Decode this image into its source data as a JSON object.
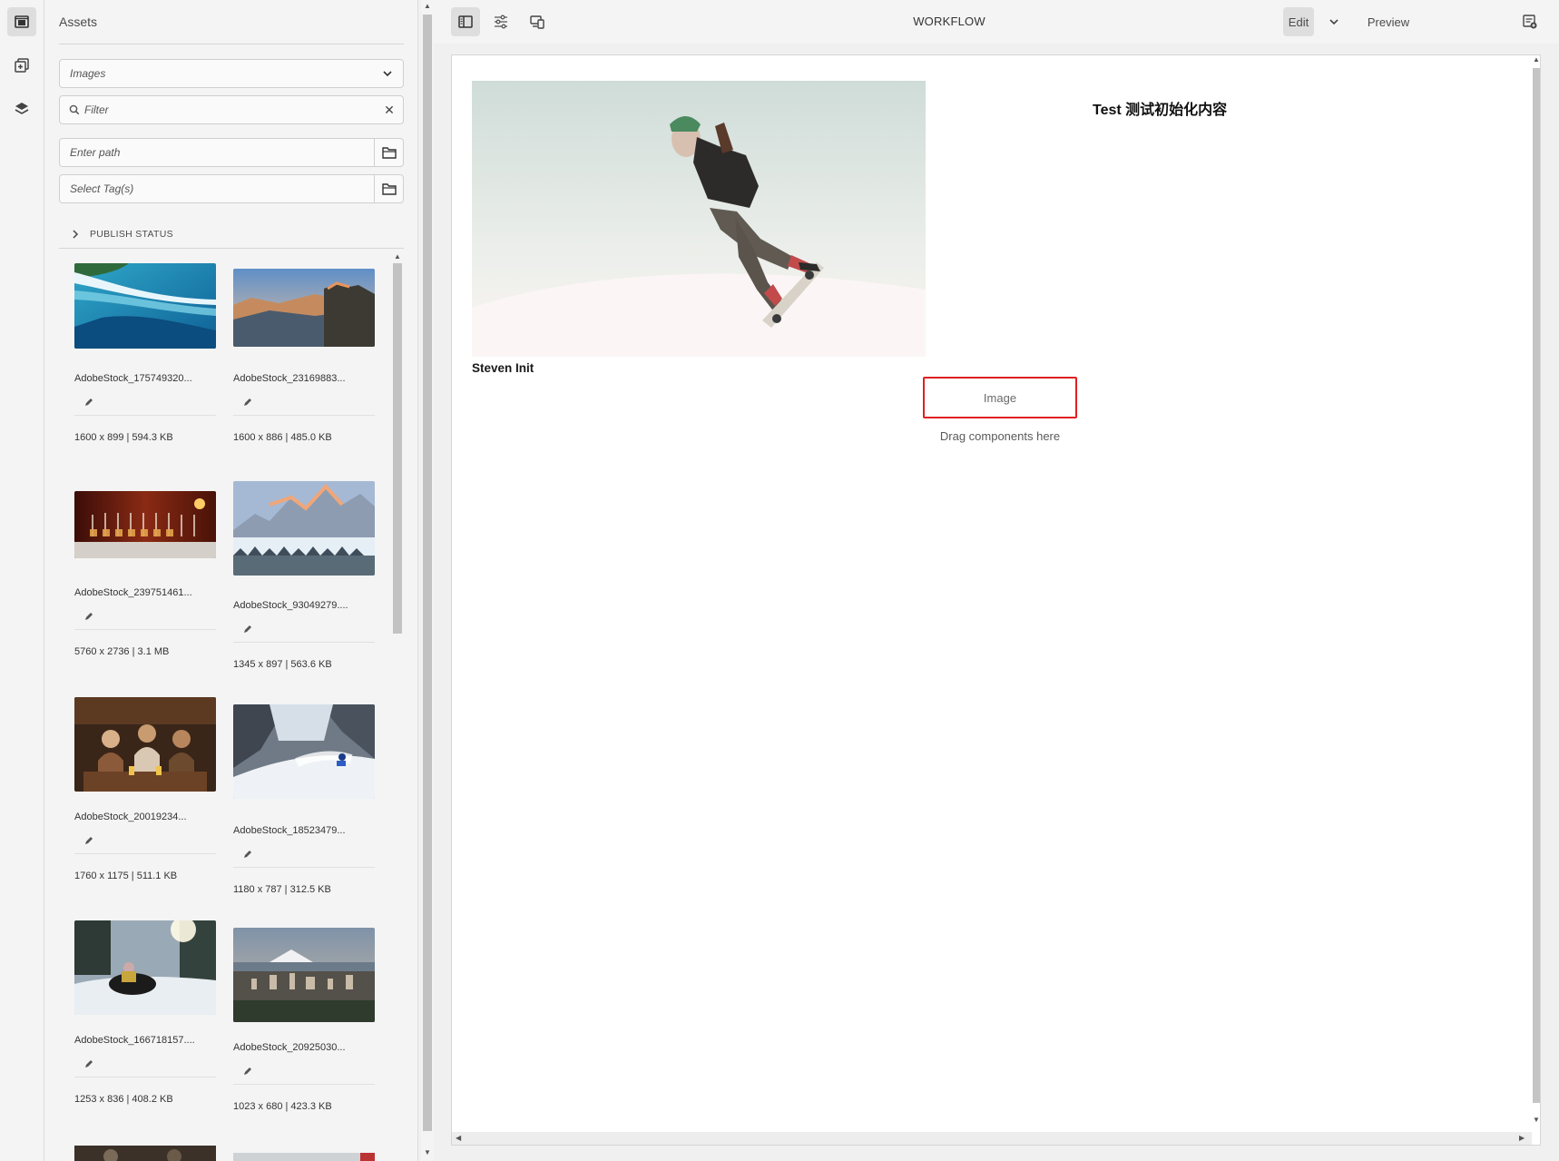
{
  "assets_panel": {
    "title": "Assets",
    "asset_type": "Images",
    "filter_placeholder": "Filter",
    "path_placeholder": "Enter path",
    "tags_placeholder": "Select Tag(s)",
    "publish_status_label": "PUBLISH STATUS",
    "assets": [
      {
        "name": "AdobeStock_175749320...",
        "meta": "1600 x 899 | 594.3 KB",
        "scene": "surf-wave"
      },
      {
        "name": "AdobeStock_23169883...",
        "meta": "1600 x 886 | 485.0 KB",
        "scene": "mountain-cliff"
      },
      {
        "name": "AdobeStock_239751461...",
        "meta": "5760 x 2736 | 3.1 MB",
        "scene": "wine-glasses"
      },
      {
        "name": "AdobeStock_93049279....",
        "meta": "1345 x 897 | 563.6 KB",
        "scene": "snowy-peaks"
      },
      {
        "name": "AdobeStock_20019234...",
        "meta": "1760 x 1175 | 511.1 KB",
        "scene": "friends-dining"
      },
      {
        "name": "AdobeStock_18523479...",
        "meta": "1180 x 787 | 312.5 KB",
        "scene": "skier-powder"
      },
      {
        "name": "AdobeStock_166718157....",
        "meta": "1253 x 836 | 408.2 KB",
        "scene": "snowmobile"
      },
      {
        "name": "AdobeStock_20925030...",
        "meta": "1023 x 680 | 423.3 KB",
        "scene": "city-mountain"
      }
    ]
  },
  "toolbar": {
    "title": "WORKFLOW",
    "edit_label": "Edit",
    "preview_label": "Preview"
  },
  "page": {
    "heading": "Test 测试初始化内容",
    "hero_caption": "Steven Init",
    "image_placeholder": "Image",
    "drag_hint": "Drag components here"
  }
}
